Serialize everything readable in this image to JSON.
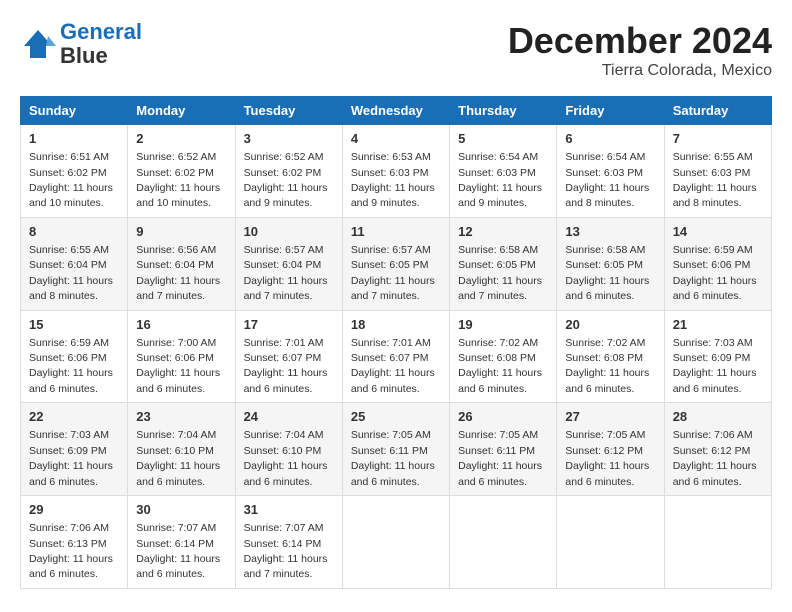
{
  "logo": {
    "line1": "General",
    "line2": "Blue"
  },
  "title": "December 2024",
  "subtitle": "Tierra Colorada, Mexico",
  "days_of_week": [
    "Sunday",
    "Monday",
    "Tuesday",
    "Wednesday",
    "Thursday",
    "Friday",
    "Saturday"
  ],
  "weeks": [
    [
      {
        "num": "1",
        "sunrise": "6:51 AM",
        "sunset": "6:02 PM",
        "daylight": "11 hours and 10 minutes."
      },
      {
        "num": "2",
        "sunrise": "6:52 AM",
        "sunset": "6:02 PM",
        "daylight": "11 hours and 10 minutes."
      },
      {
        "num": "3",
        "sunrise": "6:52 AM",
        "sunset": "6:02 PM",
        "daylight": "11 hours and 9 minutes."
      },
      {
        "num": "4",
        "sunrise": "6:53 AM",
        "sunset": "6:03 PM",
        "daylight": "11 hours and 9 minutes."
      },
      {
        "num": "5",
        "sunrise": "6:54 AM",
        "sunset": "6:03 PM",
        "daylight": "11 hours and 9 minutes."
      },
      {
        "num": "6",
        "sunrise": "6:54 AM",
        "sunset": "6:03 PM",
        "daylight": "11 hours and 8 minutes."
      },
      {
        "num": "7",
        "sunrise": "6:55 AM",
        "sunset": "6:03 PM",
        "daylight": "11 hours and 8 minutes."
      }
    ],
    [
      {
        "num": "8",
        "sunrise": "6:55 AM",
        "sunset": "6:04 PM",
        "daylight": "11 hours and 8 minutes."
      },
      {
        "num": "9",
        "sunrise": "6:56 AM",
        "sunset": "6:04 PM",
        "daylight": "11 hours and 7 minutes."
      },
      {
        "num": "10",
        "sunrise": "6:57 AM",
        "sunset": "6:04 PM",
        "daylight": "11 hours and 7 minutes."
      },
      {
        "num": "11",
        "sunrise": "6:57 AM",
        "sunset": "6:05 PM",
        "daylight": "11 hours and 7 minutes."
      },
      {
        "num": "12",
        "sunrise": "6:58 AM",
        "sunset": "6:05 PM",
        "daylight": "11 hours and 7 minutes."
      },
      {
        "num": "13",
        "sunrise": "6:58 AM",
        "sunset": "6:05 PM",
        "daylight": "11 hours and 6 minutes."
      },
      {
        "num": "14",
        "sunrise": "6:59 AM",
        "sunset": "6:06 PM",
        "daylight": "11 hours and 6 minutes."
      }
    ],
    [
      {
        "num": "15",
        "sunrise": "6:59 AM",
        "sunset": "6:06 PM",
        "daylight": "11 hours and 6 minutes."
      },
      {
        "num": "16",
        "sunrise": "7:00 AM",
        "sunset": "6:06 PM",
        "daylight": "11 hours and 6 minutes."
      },
      {
        "num": "17",
        "sunrise": "7:01 AM",
        "sunset": "6:07 PM",
        "daylight": "11 hours and 6 minutes."
      },
      {
        "num": "18",
        "sunrise": "7:01 AM",
        "sunset": "6:07 PM",
        "daylight": "11 hours and 6 minutes."
      },
      {
        "num": "19",
        "sunrise": "7:02 AM",
        "sunset": "6:08 PM",
        "daylight": "11 hours and 6 minutes."
      },
      {
        "num": "20",
        "sunrise": "7:02 AM",
        "sunset": "6:08 PM",
        "daylight": "11 hours and 6 minutes."
      },
      {
        "num": "21",
        "sunrise": "7:03 AM",
        "sunset": "6:09 PM",
        "daylight": "11 hours and 6 minutes."
      }
    ],
    [
      {
        "num": "22",
        "sunrise": "7:03 AM",
        "sunset": "6:09 PM",
        "daylight": "11 hours and 6 minutes."
      },
      {
        "num": "23",
        "sunrise": "7:04 AM",
        "sunset": "6:10 PM",
        "daylight": "11 hours and 6 minutes."
      },
      {
        "num": "24",
        "sunrise": "7:04 AM",
        "sunset": "6:10 PM",
        "daylight": "11 hours and 6 minutes."
      },
      {
        "num": "25",
        "sunrise": "7:05 AM",
        "sunset": "6:11 PM",
        "daylight": "11 hours and 6 minutes."
      },
      {
        "num": "26",
        "sunrise": "7:05 AM",
        "sunset": "6:11 PM",
        "daylight": "11 hours and 6 minutes."
      },
      {
        "num": "27",
        "sunrise": "7:05 AM",
        "sunset": "6:12 PM",
        "daylight": "11 hours and 6 minutes."
      },
      {
        "num": "28",
        "sunrise": "7:06 AM",
        "sunset": "6:12 PM",
        "daylight": "11 hours and 6 minutes."
      }
    ],
    [
      {
        "num": "29",
        "sunrise": "7:06 AM",
        "sunset": "6:13 PM",
        "daylight": "11 hours and 6 minutes."
      },
      {
        "num": "30",
        "sunrise": "7:07 AM",
        "sunset": "6:14 PM",
        "daylight": "11 hours and 6 minutes."
      },
      {
        "num": "31",
        "sunrise": "7:07 AM",
        "sunset": "6:14 PM",
        "daylight": "11 hours and 7 minutes."
      },
      null,
      null,
      null,
      null
    ]
  ],
  "labels": {
    "sunrise": "Sunrise:",
    "sunset": "Sunset:",
    "daylight": "Daylight:"
  }
}
